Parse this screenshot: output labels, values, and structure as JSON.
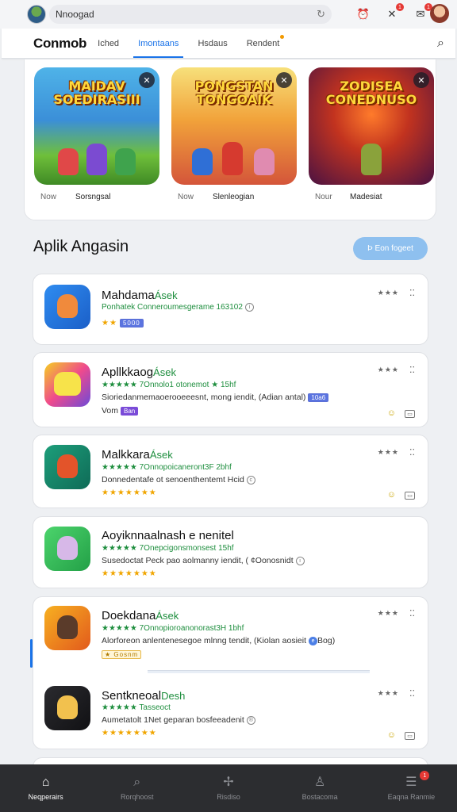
{
  "topbar": {
    "search_text": "Nnoogad",
    "refresh_glyph": "↻",
    "icons": [
      {
        "name": "alarm-icon",
        "glyph": "⏰",
        "badge": ""
      },
      {
        "name": "tools-icon",
        "glyph": "✕",
        "badge": "1"
      },
      {
        "name": "message-icon",
        "glyph": "✉",
        "badge": "1"
      }
    ]
  },
  "tabs": {
    "brand": "Conmob",
    "items": [
      {
        "label": "Iched",
        "active": false
      },
      {
        "label": "Imontaans",
        "active": true
      },
      {
        "label": "Hsdaus",
        "active": false
      },
      {
        "label": "Rendent",
        "active": false
      }
    ],
    "search_glyph": "⌕"
  },
  "featured": [
    {
      "title": "MAIDAV SOEDIRASIII",
      "meta_key": "Now",
      "meta_val": "Sorsngsal",
      "corner": "✕"
    },
    {
      "title": "PONGSTAN TONGOAIK",
      "meta_key": "Now",
      "meta_val": "Slenleogian",
      "corner": "✕"
    },
    {
      "title": "ZODISEA CONEDNUSO",
      "meta_key": "Nour",
      "meta_val": "Madesiat",
      "corner": "✕"
    }
  ],
  "section": {
    "title": "Aplik Angasin",
    "button": "Þ Eon fogeet"
  },
  "apps": [
    {
      "name": "Mahdama",
      "tag": "Ásek",
      "line1": "Ponhatek Conneroumesgerame 163102",
      "line1_circle": "i",
      "line2_stars": "★★",
      "line2_pill": "5000",
      "actions": "none"
    },
    {
      "name": "Apllkkaog",
      "tag": "Ásek",
      "line1": "★★★★★ 7Onnolo1 otonemot ★ 15hf",
      "line2": "Sioriedanmemaoerooeeesnt, mong iendit, (Adian antal)",
      "line2_pill": "10a6",
      "line3": "Vom",
      "line3_pill": "Ban",
      "actions": "icons"
    },
    {
      "name": "Malkkara",
      "tag": "Ásek",
      "line1": "★★★★★ 7Onnopoicaneront3F 2bhf",
      "line2": "Donnedentafe ot senoenthentemt Hcid",
      "line2_circle": "c",
      "stars": "★★★★★★★",
      "actions": "icons"
    },
    {
      "name": "Aoyiknnaalnash e nenitel",
      "tag": "",
      "line1": "★★★★★ 7Onepcigonsmonsest 15hf",
      "line2": "Susedoctat Peck pao aolmanny iendit, ( ¢Oonosnidt",
      "line2_circle": "ı",
      "stars": "★★★★★★★",
      "actions": "none"
    },
    {
      "name": "Doekdana",
      "tag": "Ásek",
      "line1": "★★★★★ 7Onnopioroanonorast3H 1bhf",
      "line2": "Alorforeon anlentenesegoe mlnng tendit, (Kiolan aosieit",
      "line2_pill_circle": "e",
      "line2_tail": "Bog)",
      "line3": "★ Gosnm",
      "actions": "none"
    },
    {
      "name": "Sentkneoal",
      "tag": "Desh",
      "line1": "★★★★★ Tasseoct",
      "line2": "Aumetatolt 1Net geparan bosfeeadenit",
      "line2_circle": "®",
      "stars": "★★★★★★★",
      "actions": "icons"
    }
  ],
  "card_misc": {
    "more_glyph": "★★★",
    "kebab_glyph": "⁚⁚",
    "smile_glyph": "☺",
    "box_glyph": "▭"
  },
  "bottomnav": [
    {
      "label": "Neqperairs",
      "glyph": "⌂",
      "active": true,
      "badge": ""
    },
    {
      "label": "Rorqhoost",
      "glyph": "⌕",
      "active": false,
      "badge": ""
    },
    {
      "label": "Risdiso",
      "glyph": "✢",
      "active": false,
      "badge": ""
    },
    {
      "label": "Bostacoma",
      "glyph": "♙",
      "active": false,
      "badge": ""
    },
    {
      "label": "Eaqna Ranmie",
      "glyph": "☰",
      "active": false,
      "badge": "1"
    }
  ]
}
